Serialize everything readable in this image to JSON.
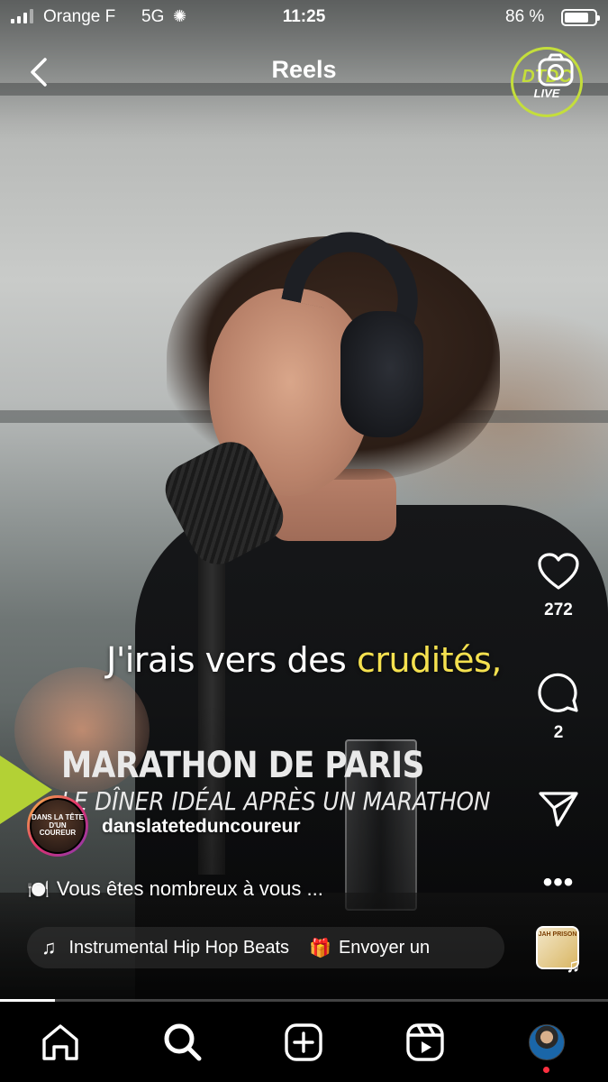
{
  "status_bar": {
    "carrier": "Orange F",
    "network": "5G",
    "time": "11:25",
    "battery_percent": "86 %"
  },
  "header": {
    "title": "Reels",
    "watermark_top": "DTDC",
    "watermark_bottom": "LIVE"
  },
  "video": {
    "subtitle_plain": "J'irais vers des ",
    "subtitle_highlight": "crudités,",
    "overlay_title": "MARATHON DE PARIS",
    "overlay_subtitle": "LE DÎNER IDÉAL APRÈS UN MARATHON",
    "progress": 0.09
  },
  "actions": {
    "like_count": "272",
    "comment_count": "2",
    "more_label": "•••"
  },
  "post": {
    "avatar_text": "DANS LA TÊTE D'UN COUREUR",
    "username": "danslateteduncoureur",
    "caption_emoji": "🍽️",
    "caption": "Vous êtes nombreux à vous ...",
    "audio_text": "Instrumental Hip Hop Beats",
    "gift_text": "Envoyer un",
    "audio_thumb_text": "JAH PRISON"
  },
  "nav": {
    "items": [
      "home",
      "search",
      "create",
      "reels",
      "profile"
    ]
  },
  "colors": {
    "subtitle_highlight": "#f5e14f",
    "brand_green": "#c4de3b",
    "notification_dot": "#ff3040"
  }
}
